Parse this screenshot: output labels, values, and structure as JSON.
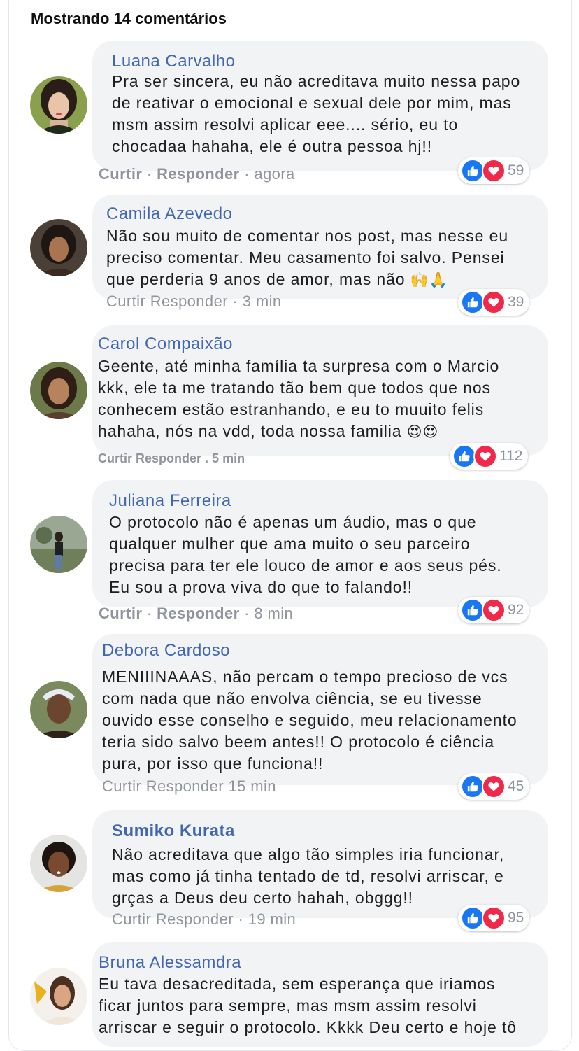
{
  "header": "Mostrando 14 comentários",
  "labels": {
    "like": "Curtir",
    "reply": "Responder"
  },
  "comments": [
    {
      "name": "Luana Carvalho",
      "lines": [
        "Pra ser sincera, eu não acreditava muito nessa papo",
        "de reativar o emocional e sexual dele por mim, mas",
        "msm assim resolvi aplicar eee.... sério, eu to",
        "chocadaa hahaha, ele é outra pessoa hj!!"
      ],
      "time": "agora",
      "count": "59"
    },
    {
      "name": "Camila Azevedo",
      "lines": [
        "Não sou muito de comentar nos post, mas nesse eu",
        "preciso comentar. Meu casamento foi salvo. Pensei",
        "que perderia 9 anos de amor, mas não"
      ],
      "emoji": "🙌🙏",
      "time": "3 min",
      "count": "39"
    },
    {
      "name": "Carol Compaixão",
      "lines": [
        "Geente, até minha família ta surpresa com o Marcio",
        "kkk, ele ta me tratando tão bem que todos que nos",
        "conhecem estão estranhando, e eu to muuito felis",
        "hahaha, nós na vdd, toda nossa familia"
      ],
      "emoji": "😍😍",
      "time": "5 min",
      "count": "112"
    },
    {
      "name": "Juliana Ferreira",
      "lines": [
        "O protocolo não é apenas um áudio, mas o que",
        "qualquer mulher que ama muito o seu parceiro",
        "precisa para ter ele louco de amor e aos seus pés.",
        "Eu sou a prova viva do que to falando!!"
      ],
      "time": "8 min",
      "count": "92"
    },
    {
      "name": "Debora Cardoso",
      "lines": [
        "MENIIINAAAS, não percam o tempo precioso de vcs",
        "com nada que não envolva ciência, se eu tivesse",
        "ouvido esse conselho e seguido, meu relacionamento",
        "teria sido salvo beem antes!! O protocolo é ciência",
        "pura, por isso que funciona!!"
      ],
      "time": "15 min",
      "count": "45"
    },
    {
      "name": "Sumiko Kurata",
      "lines": [
        "Não acreditava que algo tão simples iria funcionar,",
        "mas como já tinha tentado de td, resolvi arriscar, e",
        "grças a Deus deu certo hahah, obggg!!"
      ],
      "time": "19 min",
      "count": "95"
    },
    {
      "name": "Bruna Alessamdra",
      "lines": [
        "Eu tava desacreditada, sem esperança que iriamos",
        "ficar juntos para sempre, mas msm assim resolvi",
        "arriscar e seguir o protocolo. Kkkk Deu certo e hoje tô"
      ]
    }
  ],
  "colors": {
    "name": "#4267b2",
    "like": "#1877f2",
    "love": "#f0284a",
    "meta": "#90949c",
    "bubble": "#f2f3f5"
  }
}
